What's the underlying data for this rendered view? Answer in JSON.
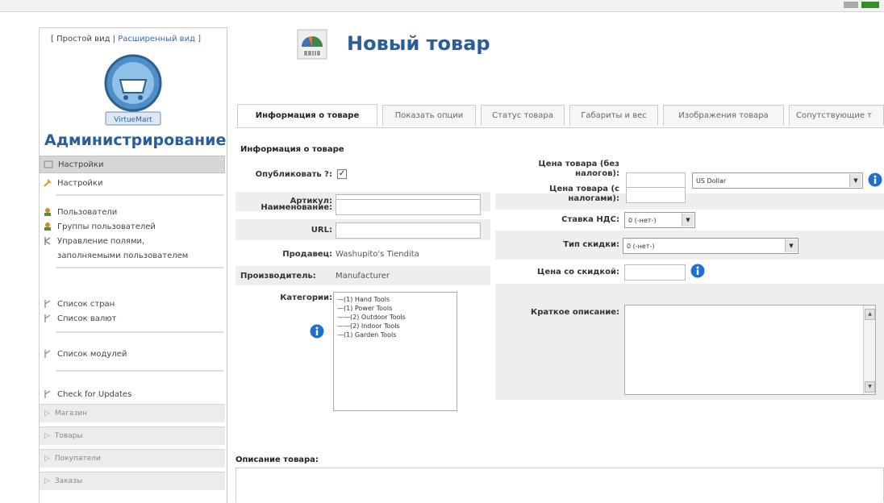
{
  "sidebar": {
    "view_simple": "[ Простой вид |",
    "view_extended": " Расширенный вид ]",
    "logo_text": "VirtueMart",
    "admin_title": "Администрирование",
    "menu_head": "Настройки",
    "items": [
      {
        "label": "Настройки",
        "icon": "tools-icon"
      },
      {
        "label": "Пользователи",
        "icon": "users-icon"
      },
      {
        "label": "Группы пользователей",
        "icon": "user-groups-icon"
      },
      {
        "label": "Управление полями,",
        "icon": "fields-icon"
      },
      {
        "label": "заполняемыми пользователем",
        "icon": ""
      },
      {
        "label": "Список стран",
        "icon": "list-icon"
      },
      {
        "label": "Список валют",
        "icon": "list-icon"
      },
      {
        "label": "Список модулей",
        "icon": "list-icon"
      },
      {
        "label": "Check for Updates",
        "icon": "list-icon"
      }
    ],
    "sections": [
      "Магазин",
      "Товары",
      "Покупатели",
      "Заказы"
    ]
  },
  "header": {
    "title": "Новый товар",
    "icon": "product-box-icon"
  },
  "tabs": [
    "Информация о товаре",
    "Показать опции",
    "Статус товара",
    "Габариты и вес",
    "Изображения товара",
    "Сопутствующие т"
  ],
  "form": {
    "section_title": "Информация о товаре",
    "publish_label": "Опубликовать ?:",
    "publish_checked": "✓",
    "sku_label": "Артикул:",
    "sku_value": "",
    "name_label": "Наименование:",
    "name_value": "",
    "url_label": "URL:",
    "url_value": "",
    "vendor_label": "Продавец:",
    "vendor_value": "Washupito's Tiendita",
    "manufacturer_label": "Производитель:",
    "manufacturer_value": "Manufacturer",
    "categories_label": "Категории:",
    "categories": [
      "—(1) Hand Tools",
      "—(1) Power Tools",
      "——(2) Outdoor Tools",
      "——(2) Indoor Tools",
      "—(1) Garden Tools"
    ]
  },
  "pricing": {
    "price_net_label_1": "Цена товара (без",
    "price_net_label_2": "налогов):",
    "price_net_value": "",
    "currency": "US Dollar",
    "price_gross_label_1": "Цена товара (с",
    "price_gross_label_2": "налогами):",
    "price_gross_value": "",
    "vat_label": "Ставка НДС:",
    "vat_value": "0 (-нет-)",
    "discount_type_label": "Тип скидки:",
    "discount_type_value": "0 (-нет-)",
    "discounted_price_label": "Цена со скидкой:",
    "discounted_price_value": "",
    "short_desc_label": "Краткое описание:",
    "short_desc_value": ""
  },
  "description": {
    "label": "Описание товара:"
  },
  "colors": {
    "accent": "#2a5d9c",
    "info_icon": "#1e6fd0"
  }
}
